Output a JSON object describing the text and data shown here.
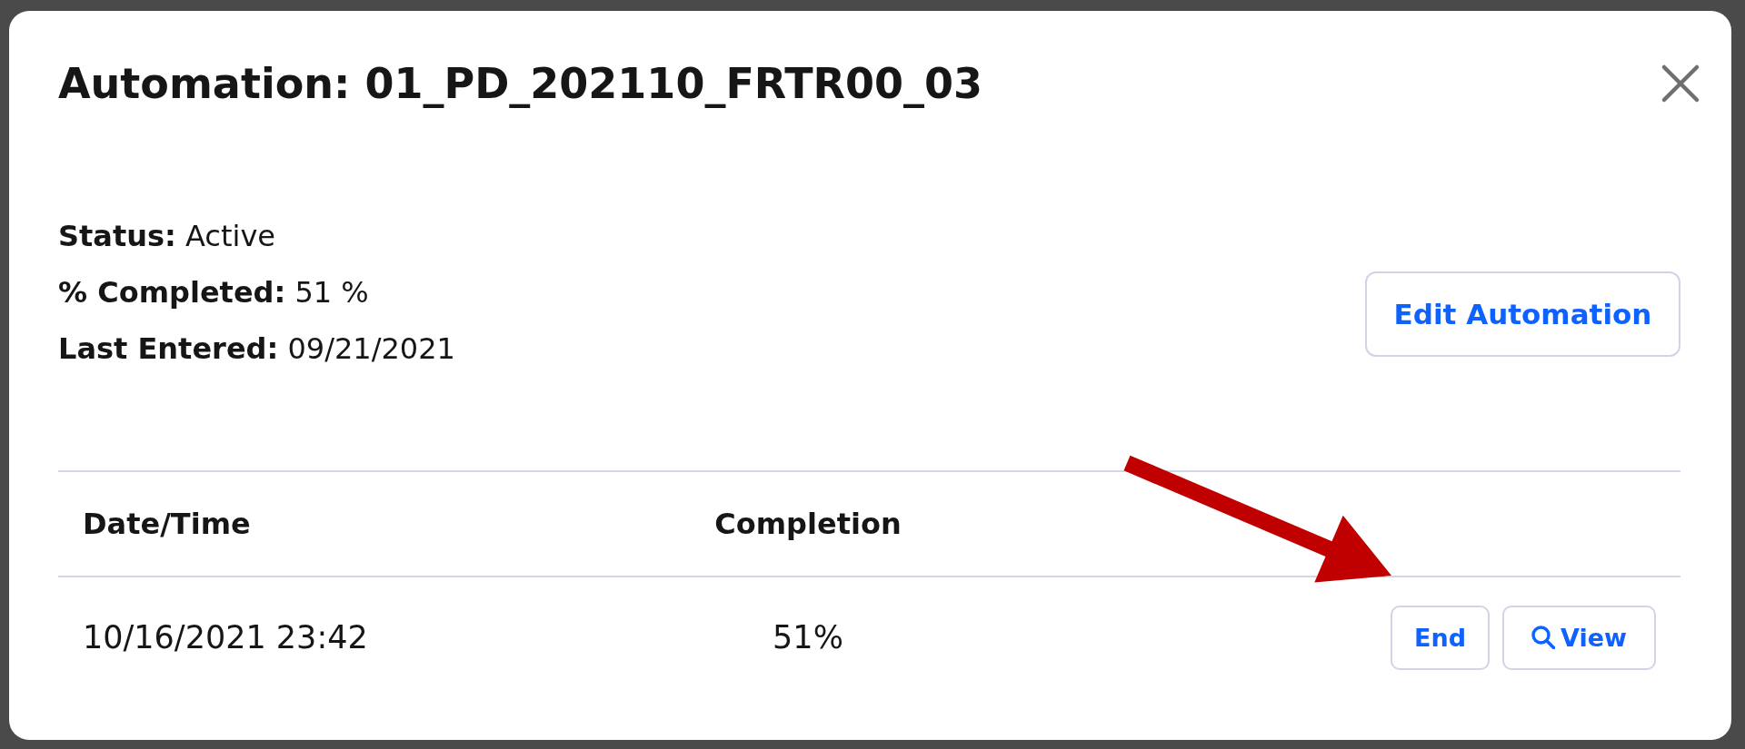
{
  "dialog": {
    "title": "Automation: 01_PD_202110_FRTR00_03",
    "closable": true
  },
  "details": [
    {
      "label": "Status:",
      "value": "Active"
    },
    {
      "label": "% Completed:",
      "value": "51 %"
    },
    {
      "label": "Last Entered:",
      "value": "09/21/2021"
    }
  ],
  "edit_button": {
    "label": "Edit Automation"
  },
  "table": {
    "columns": [
      {
        "label": "Date/Time"
      },
      {
        "label": "Completion"
      }
    ],
    "rows": [
      {
        "date_time": "10/16/2021 23:42",
        "completion": "51%",
        "actions": [
          {
            "kind": "plain",
            "label": "End"
          },
          {
            "kind": "search",
            "label": "View"
          }
        ]
      }
    ]
  },
  "annotations": [
    {
      "kind": "arrow"
    }
  ]
}
